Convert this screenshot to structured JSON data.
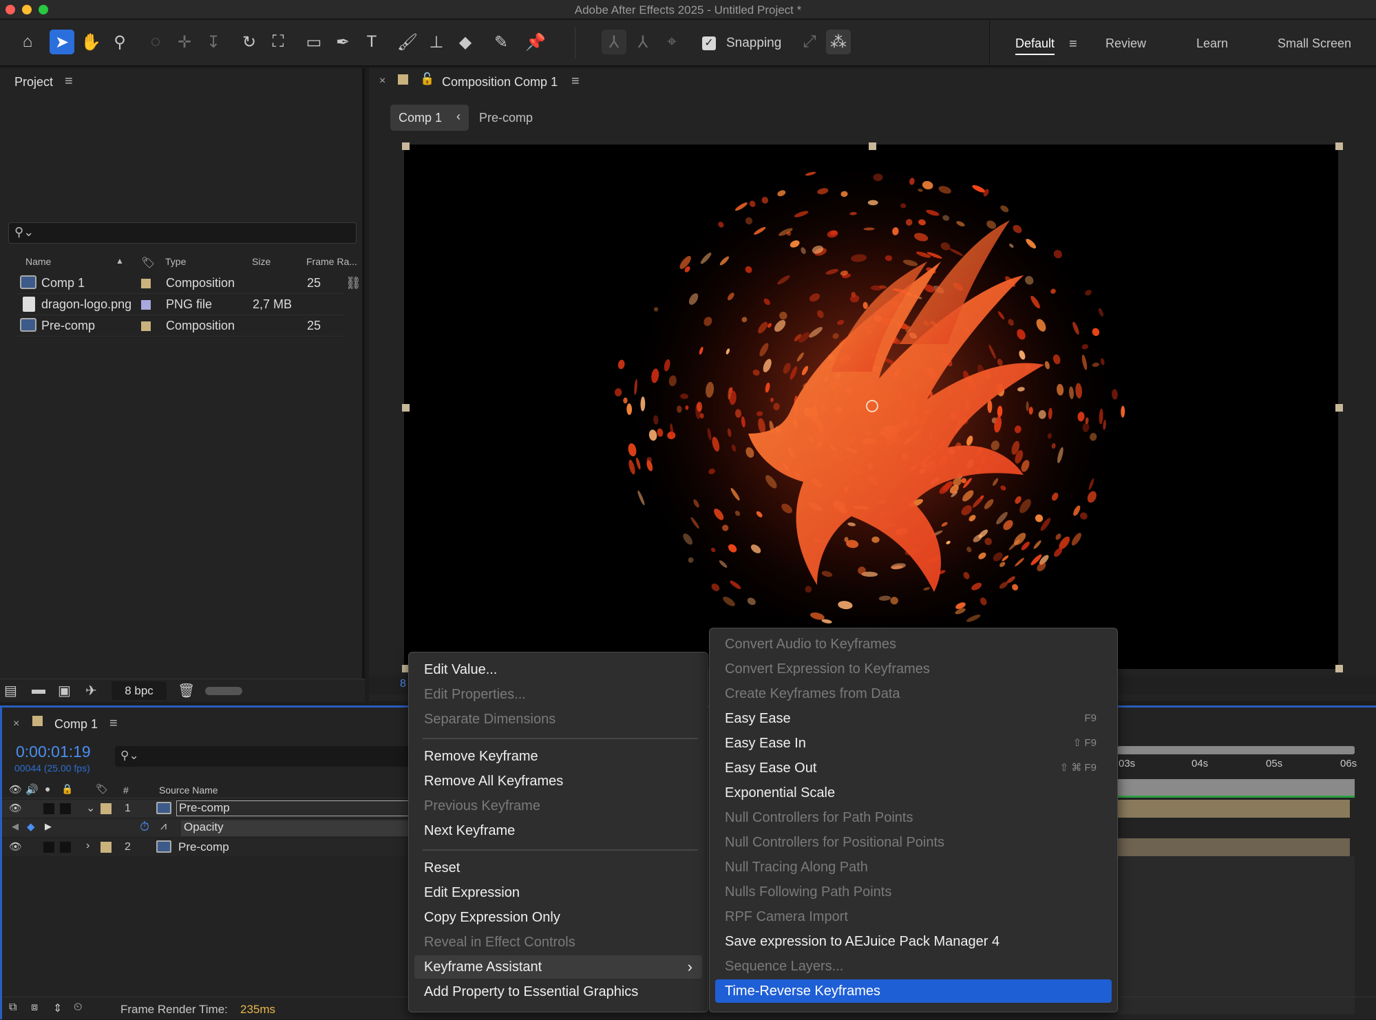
{
  "window": {
    "title": "Adobe After Effects 2025 - Untitled Project *"
  },
  "toolbar": {
    "snapping_label": "Snapping",
    "snapping_checked": true,
    "workspaces": [
      "Default",
      "Review",
      "Learn",
      "Small Screen"
    ],
    "active_workspace": "Default"
  },
  "project": {
    "title": "Project",
    "search_placeholder": "",
    "columns": {
      "name": "Name",
      "type": "Type",
      "size": "Size",
      "frame_rate": "Frame Ra..."
    },
    "items": [
      {
        "name": "Comp 1",
        "type": "Composition",
        "size": "",
        "fps": "25",
        "label_color": "#c9b27d",
        "icon": "composition-icon"
      },
      {
        "name": "dragon-logo.png",
        "type": "PNG file",
        "size": "2,7 MB",
        "fps": "",
        "label_color": "#a9a9e0",
        "icon": "png-file-icon"
      },
      {
        "name": "Pre-comp",
        "type": "Composition",
        "size": "",
        "fps": "25",
        "label_color": "#c9b27d",
        "icon": "composition-icon"
      }
    ],
    "bpc": "8 bpc"
  },
  "composition": {
    "title": "Composition Comp 1",
    "breadcrumb": [
      "Comp 1",
      "Pre-comp"
    ],
    "footer_partial": "8"
  },
  "timeline": {
    "tab": "Comp 1",
    "timecode": "0:00:01:19",
    "frame_info": "00044 (25.00 fps)",
    "source_name_header": "Source Name",
    "index_header": "#",
    "layers": [
      {
        "index": "1",
        "name": "Pre-comp",
        "expanded": true
      },
      {
        "index": "2",
        "name": "Pre-comp",
        "expanded": false
      }
    ],
    "property": "Opacity",
    "ruler": [
      "03s",
      "04s",
      "05s",
      "06s"
    ],
    "render_time_label": "Frame Render Time:",
    "render_time_value": "235ms"
  },
  "context_menu": {
    "items": [
      {
        "label": "Edit Value...",
        "disabled": false
      },
      {
        "label": "Edit Properties...",
        "disabled": true
      },
      {
        "label": "Separate Dimensions",
        "disabled": true
      },
      {
        "label": "Remove Keyframe",
        "disabled": false
      },
      {
        "label": "Remove All Keyframes",
        "disabled": false
      },
      {
        "label": "Previous Keyframe",
        "disabled": true
      },
      {
        "label": "Next Keyframe",
        "disabled": false
      },
      {
        "label": "Reset",
        "disabled": false
      },
      {
        "label": "Edit Expression",
        "disabled": false
      },
      {
        "label": "Copy Expression Only",
        "disabled": false
      },
      {
        "label": "Reveal in Effect Controls",
        "disabled": true
      },
      {
        "label": "Keyframe Assistant",
        "disabled": false
      },
      {
        "label": "Add Property to Essential Graphics",
        "disabled": false
      }
    ]
  },
  "submenu": {
    "items": [
      {
        "label": "Convert Audio to Keyframes",
        "disabled": true,
        "shortcut": ""
      },
      {
        "label": "Convert Expression to Keyframes",
        "disabled": true,
        "shortcut": ""
      },
      {
        "label": "Create Keyframes from Data",
        "disabled": true,
        "shortcut": ""
      },
      {
        "label": "Easy Ease",
        "disabled": false,
        "shortcut": "F9"
      },
      {
        "label": "Easy Ease In",
        "disabled": false,
        "shortcut": "⇧ F9"
      },
      {
        "label": "Easy Ease Out",
        "disabled": false,
        "shortcut": "⇧ ⌘ F9"
      },
      {
        "label": "Exponential Scale",
        "disabled": false,
        "shortcut": ""
      },
      {
        "label": "Null Controllers for Path Points",
        "disabled": true,
        "shortcut": ""
      },
      {
        "label": "Null Controllers for Positional Points",
        "disabled": true,
        "shortcut": ""
      },
      {
        "label": "Null Tracing Along Path",
        "disabled": true,
        "shortcut": ""
      },
      {
        "label": "Nulls Following Path Points",
        "disabled": true,
        "shortcut": ""
      },
      {
        "label": "RPF Camera Import",
        "disabled": true,
        "shortcut": ""
      },
      {
        "label": "Save expression to AEJuice Pack Manager 4",
        "disabled": false,
        "shortcut": ""
      },
      {
        "label": "Sequence Layers...",
        "disabled": true,
        "shortcut": ""
      },
      {
        "label": "Time-Reverse Keyframes",
        "disabled": false,
        "shortcut": "",
        "highlighted": true
      }
    ]
  },
  "colors": {
    "accent": "#1f5fd6",
    "timecode": "#4a8ff0",
    "render_time": "#e8b74a"
  }
}
